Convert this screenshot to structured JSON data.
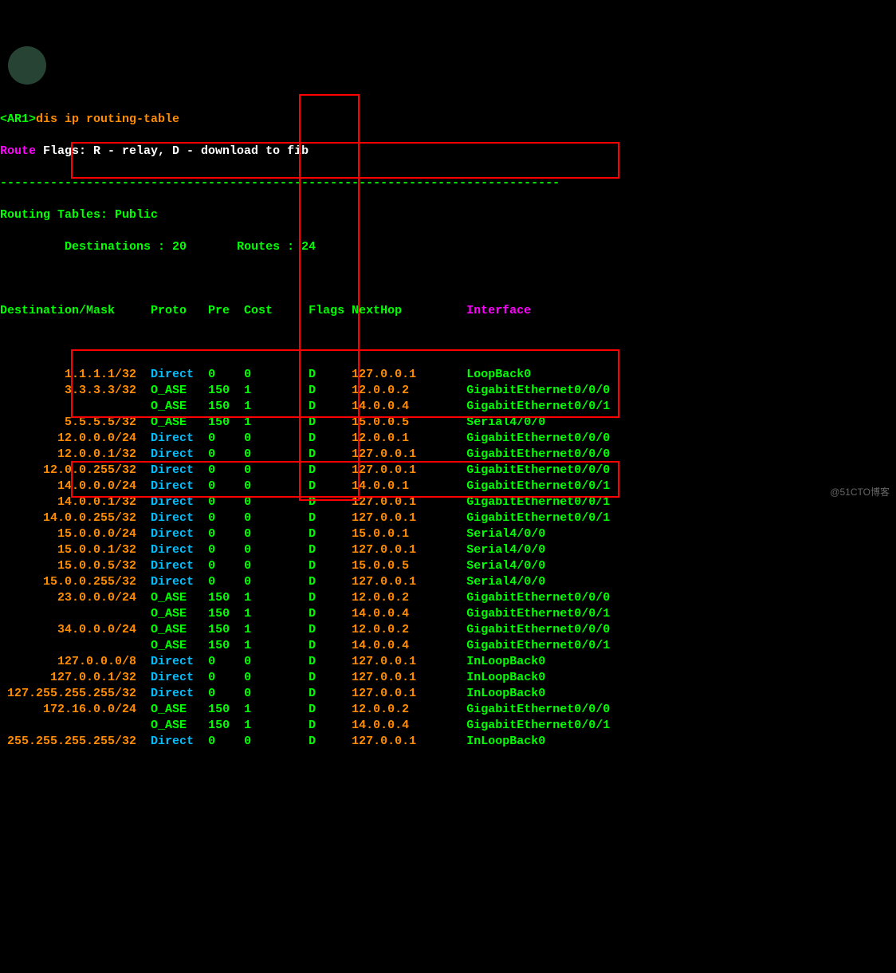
{
  "prompt": "<AR1>",
  "command": "dis ip routing-table",
  "flags_line": {
    "route": "Route",
    "rest": " Flags: R - relay, D - download to fib"
  },
  "divider": "------------------------------------------------------------------------------",
  "tables_line": "Routing Tables: Public",
  "dest_line": "         Destinations : 20       ",
  "routes_line": "Routes : 24",
  "headers": {
    "dest": "Destination/Mask",
    "proto": "Proto",
    "pre": "Pre",
    "cost": "Cost",
    "flags": "Flags",
    "nexthop": "NextHop",
    "interface": "Interface"
  },
  "rows": [
    {
      "dest": "1.1.1.1/32",
      "proto": "Direct",
      "pre": "0",
      "cost": "0",
      "flags": "D",
      "nexthop": "127.0.0.1",
      "iface": "LoopBack0"
    },
    {
      "dest": "3.3.3.3/32",
      "proto": "O_ASE",
      "pre": "150",
      "cost": "1",
      "flags": "D",
      "nexthop": "12.0.0.2",
      "iface": "GigabitEthernet0/0/0"
    },
    {
      "dest": "",
      "proto": "O_ASE",
      "pre": "150",
      "cost": "1",
      "flags": "D",
      "nexthop": "14.0.0.4",
      "iface": "GigabitEthernet0/0/1"
    },
    {
      "dest": "5.5.5.5/32",
      "proto": "O_ASE",
      "pre": "150",
      "cost": "1",
      "flags": "D",
      "nexthop": "15.0.0.5",
      "iface": "Serial4/0/0"
    },
    {
      "dest": "12.0.0.0/24",
      "proto": "Direct",
      "pre": "0",
      "cost": "0",
      "flags": "D",
      "nexthop": "12.0.0.1",
      "iface": "GigabitEthernet0/0/0"
    },
    {
      "dest": "12.0.0.1/32",
      "proto": "Direct",
      "pre": "0",
      "cost": "0",
      "flags": "D",
      "nexthop": "127.0.0.1",
      "iface": "GigabitEthernet0/0/0"
    },
    {
      "dest": "12.0.0.255/32",
      "proto": "Direct",
      "pre": "0",
      "cost": "0",
      "flags": "D",
      "nexthop": "127.0.0.1",
      "iface": "GigabitEthernet0/0/0"
    },
    {
      "dest": "14.0.0.0/24",
      "proto": "Direct",
      "pre": "0",
      "cost": "0",
      "flags": "D",
      "nexthop": "14.0.0.1",
      "iface": "GigabitEthernet0/0/1"
    },
    {
      "dest": "14.0.0.1/32",
      "proto": "Direct",
      "pre": "0",
      "cost": "0",
      "flags": "D",
      "nexthop": "127.0.0.1",
      "iface": "GigabitEthernet0/0/1"
    },
    {
      "dest": "14.0.0.255/32",
      "proto": "Direct",
      "pre": "0",
      "cost": "0",
      "flags": "D",
      "nexthop": "127.0.0.1",
      "iface": "GigabitEthernet0/0/1"
    },
    {
      "dest": "15.0.0.0/24",
      "proto": "Direct",
      "pre": "0",
      "cost": "0",
      "flags": "D",
      "nexthop": "15.0.0.1",
      "iface": "Serial4/0/0"
    },
    {
      "dest": "15.0.0.1/32",
      "proto": "Direct",
      "pre": "0",
      "cost": "0",
      "flags": "D",
      "nexthop": "127.0.0.1",
      "iface": "Serial4/0/0"
    },
    {
      "dest": "15.0.0.5/32",
      "proto": "Direct",
      "pre": "0",
      "cost": "0",
      "flags": "D",
      "nexthop": "15.0.0.5",
      "iface": "Serial4/0/0"
    },
    {
      "dest": "15.0.0.255/32",
      "proto": "Direct",
      "pre": "0",
      "cost": "0",
      "flags": "D",
      "nexthop": "127.0.0.1",
      "iface": "Serial4/0/0"
    },
    {
      "dest": "23.0.0.0/24",
      "proto": "O_ASE",
      "pre": "150",
      "cost": "1",
      "flags": "D",
      "nexthop": "12.0.0.2",
      "iface": "GigabitEthernet0/0/0"
    },
    {
      "dest": "",
      "proto": "O_ASE",
      "pre": "150",
      "cost": "1",
      "flags": "D",
      "nexthop": "14.0.0.4",
      "iface": "GigabitEthernet0/0/1"
    },
    {
      "dest": "34.0.0.0/24",
      "proto": "O_ASE",
      "pre": "150",
      "cost": "1",
      "flags": "D",
      "nexthop": "12.0.0.2",
      "iface": "GigabitEthernet0/0/0"
    },
    {
      "dest": "",
      "proto": "O_ASE",
      "pre": "150",
      "cost": "1",
      "flags": "D",
      "nexthop": "14.0.0.4",
      "iface": "GigabitEthernet0/0/1"
    },
    {
      "dest": "127.0.0.0/8",
      "proto": "Direct",
      "pre": "0",
      "cost": "0",
      "flags": "D",
      "nexthop": "127.0.0.1",
      "iface": "InLoopBack0"
    },
    {
      "dest": "127.0.0.1/32",
      "proto": "Direct",
      "pre": "0",
      "cost": "0",
      "flags": "D",
      "nexthop": "127.0.0.1",
      "iface": "InLoopBack0"
    },
    {
      "dest": "127.255.255.255/32",
      "proto": "Direct",
      "pre": "0",
      "cost": "0",
      "flags": "D",
      "nexthop": "127.0.0.1",
      "iface": "InLoopBack0"
    },
    {
      "dest": "172.16.0.0/24",
      "proto": "O_ASE",
      "pre": "150",
      "cost": "1",
      "flags": "D",
      "nexthop": "12.0.0.2",
      "iface": "GigabitEthernet0/0/0"
    },
    {
      "dest": "",
      "proto": "O_ASE",
      "pre": "150",
      "cost": "1",
      "flags": "D",
      "nexthop": "14.0.0.4",
      "iface": "GigabitEthernet0/0/1"
    },
    {
      "dest": "255.255.255.255/32",
      "proto": "Direct",
      "pre": "0",
      "cost": "0",
      "flags": "D",
      "nexthop": "127.0.0.1",
      "iface": "InLoopBack0"
    }
  ],
  "watermark": "@51CTO博客"
}
